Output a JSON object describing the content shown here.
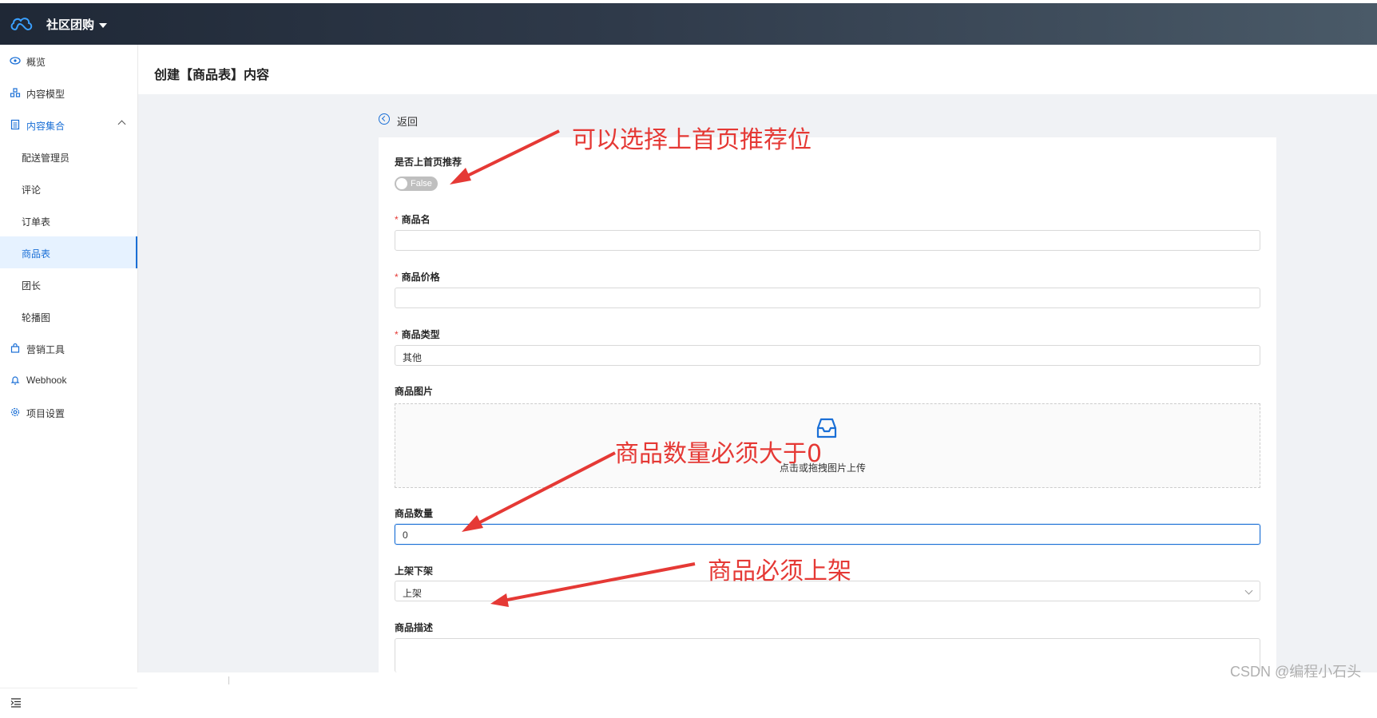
{
  "app": {
    "brand": "社区团购"
  },
  "sidebar": {
    "items": [
      {
        "label": "概览",
        "icon": "eye-icon"
      },
      {
        "label": "内容模型",
        "icon": "model-icon"
      },
      {
        "label": "内容集合",
        "icon": "document-icon",
        "expanded": true
      },
      {
        "label": "配送管理员"
      },
      {
        "label": "评论"
      },
      {
        "label": "订单表"
      },
      {
        "label": "商品表",
        "active": true
      },
      {
        "label": "团长"
      },
      {
        "label": "轮播图"
      },
      {
        "label": "营销工具",
        "icon": "bag-icon"
      },
      {
        "label": "Webhook",
        "icon": "bell-icon"
      },
      {
        "label": "项目设置",
        "icon": "gear-icon"
      }
    ]
  },
  "header": {
    "title": "创建【商品表】内容"
  },
  "form": {
    "back_label": "返回",
    "recommend": {
      "label": "是否上首页推荐",
      "value": "False"
    },
    "name": {
      "label": "商品名",
      "value": ""
    },
    "price": {
      "label": "商品价格",
      "value": ""
    },
    "type": {
      "label": "商品类型",
      "value": "其他"
    },
    "image": {
      "label": "商品图片",
      "upload_text": "点击或拖拽图片上传"
    },
    "quantity": {
      "label": "商品数量",
      "value": "0"
    },
    "shelf": {
      "label": "上架下架",
      "value": "上架"
    },
    "description": {
      "label": "商品描述",
      "value": ""
    },
    "required_marker": "*"
  },
  "annotations": {
    "recommend": "可以选择上首页推荐位",
    "quantity": "商品数量必须大于0",
    "shelf": "商品必须上架"
  },
  "watermark": "CSDN @编程小石头",
  "colors": {
    "accent": "#1a6fd6",
    "annotation": "#e53935",
    "topbar": "#1f2836"
  }
}
